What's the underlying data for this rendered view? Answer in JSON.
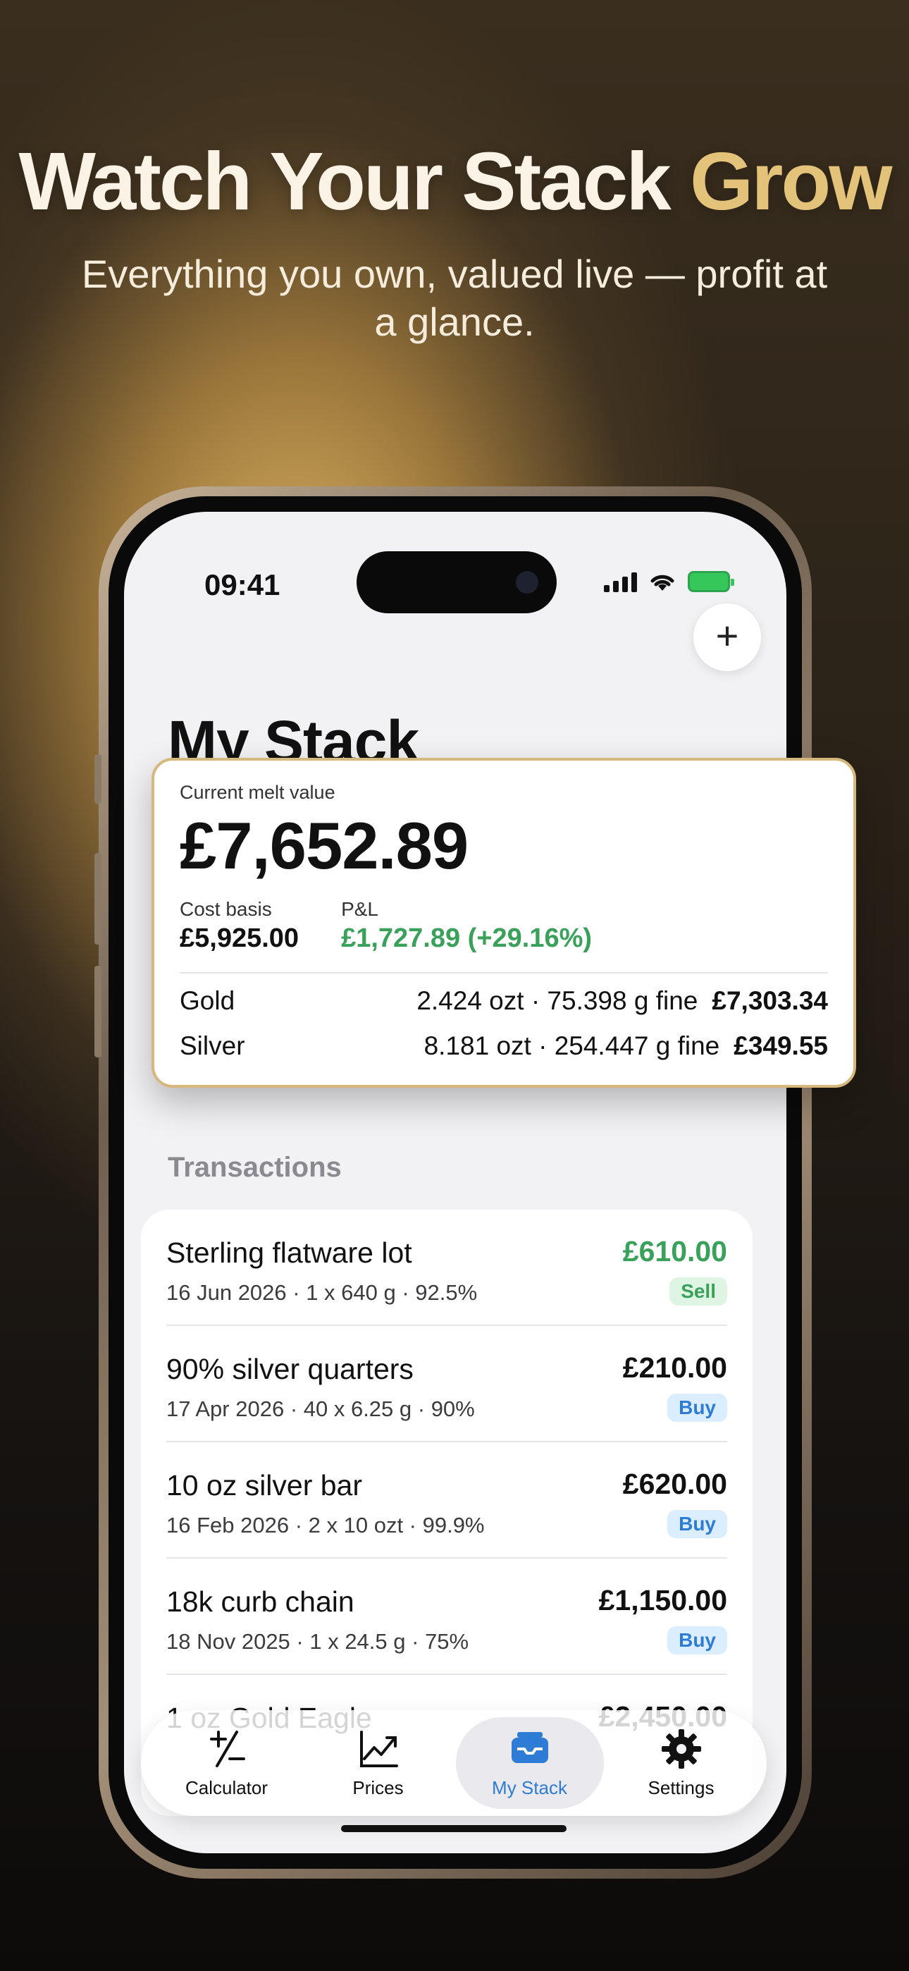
{
  "hero": {
    "title_main": "Watch Your Stack ",
    "title_accent": "Grow",
    "subtitle": "Everything you own, valued live — profit at a glance."
  },
  "status_bar": {
    "time": "09:41"
  },
  "page": {
    "title": "My Stack",
    "add_symbol": "+"
  },
  "summary": {
    "current_label": "Current melt value",
    "current_value": "£7,652.89",
    "cost_label": "Cost basis",
    "cost_value": "£5,925.00",
    "pl_label": "P&L",
    "pl_value": "£1,727.89 (+29.16%)",
    "metals": [
      {
        "name": "Gold",
        "detail": "2.424 ozt · 75.398 g fine",
        "value": "£7,303.34"
      },
      {
        "name": "Silver",
        "detail": "8.181 ozt · 254.447 g fine",
        "value": "£349.55"
      }
    ]
  },
  "transactions": {
    "header": "Transactions",
    "items": [
      {
        "name": "Sterling flatware lot",
        "meta": "16 Jun 2026 · 1 x 640 g · 92.5%",
        "amount": "£610.00",
        "type": "Sell"
      },
      {
        "name": "90% silver quarters",
        "meta": "17 Apr 2026 · 40 x 6.25 g · 90%",
        "amount": "£210.00",
        "type": "Buy"
      },
      {
        "name": "10 oz silver bar",
        "meta": "16 Feb 2026 · 2 x 10 ozt · 99.9%",
        "amount": "£620.00",
        "type": "Buy"
      },
      {
        "name": "18k curb chain",
        "meta": "18 Nov 2025 · 1 x 24.5 g · 75%",
        "amount": "£1,150.00",
        "type": "Buy"
      },
      {
        "name": "1 oz Gold Eagle",
        "meta": "",
        "amount": "£2,450.00",
        "type": ""
      }
    ]
  },
  "tabbar": {
    "tabs": [
      {
        "label": "Calculator",
        "icon": "plus-minus-icon"
      },
      {
        "label": "Prices",
        "icon": "chart-line-icon"
      },
      {
        "label": "My Stack",
        "icon": "tray-icon"
      },
      {
        "label": "Settings",
        "icon": "gear-icon"
      }
    ],
    "active": "My Stack"
  },
  "colors": {
    "gold_accent": "#e3c27a",
    "profit_green": "#3aa15a",
    "buy_blue": "#2f7cd6",
    "card_border": "#d6b77c"
  }
}
